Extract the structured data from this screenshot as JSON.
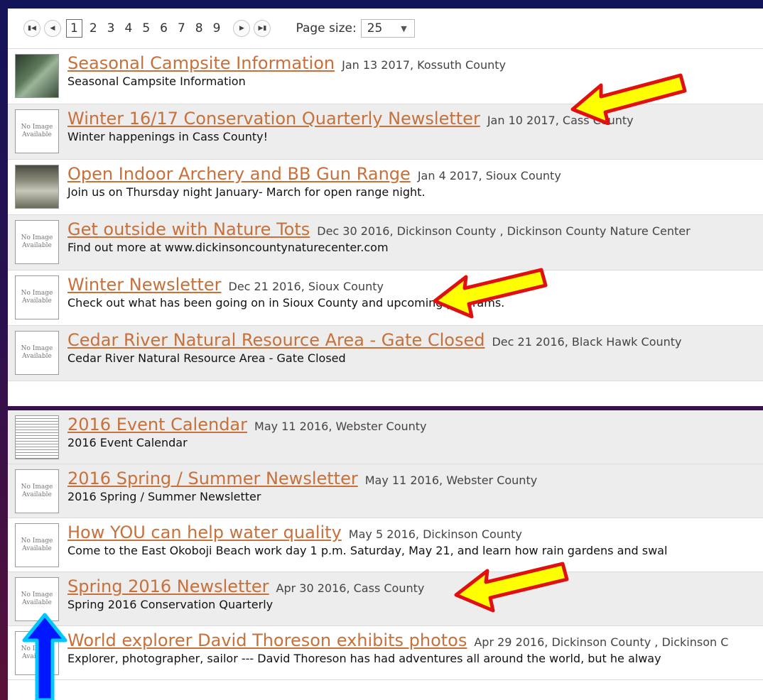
{
  "pager": {
    "first_icon": "first-page-icon",
    "prev_icon": "prev-page-icon",
    "next_icon": "next-page-icon",
    "last_icon": "last-page-icon",
    "pages": [
      "1",
      "2",
      "3",
      "4",
      "5",
      "6",
      "7",
      "8",
      "9"
    ],
    "current_page": "1",
    "page_size_label": "Page size:",
    "page_size_value": "25"
  },
  "top_items": [
    {
      "title": "Seasonal Campsite Information",
      "meta": "Jan 13 2017, Kossuth County",
      "desc": "Seasonal Campsite Information",
      "thumb": "photo"
    },
    {
      "title": "Winter 16/17 Conservation Quarterly Newsletter",
      "meta": "Jan 10 2017, Cass County",
      "desc": "Winter happenings in Cass County!",
      "thumb": "none"
    },
    {
      "title": "Open Indoor Archery and BB Gun Range",
      "meta": "Jan 4 2017, Sioux County",
      "desc": "Join us on Thursday night January- March for open range night.",
      "thumb": "photo"
    },
    {
      "title": "Get outside with Nature Tots",
      "meta": "Dec 30 2016, Dickinson County , Dickinson County Nature Center",
      "desc": "Find out more at www.dickinsoncountynaturecenter.com",
      "thumb": "none"
    },
    {
      "title": "Winter Newsletter",
      "meta": "Dec 21 2016, Sioux County",
      "desc": "Check out what has been going on in Sioux County and upcoming programs.",
      "thumb": "none"
    },
    {
      "title": "Cedar River Natural Resource Area - Gate Closed",
      "meta": "Dec 21 2016, Black Hawk County",
      "desc": "Cedar River Natural Resource Area - Gate Closed",
      "thumb": "none"
    }
  ],
  "bottom_items": [
    {
      "title": "2016 Event Calendar",
      "meta": "May 11 2016, Webster County",
      "desc": "2016 Event Calendar",
      "thumb": "doc"
    },
    {
      "title": "2016 Spring / Summer Newsletter",
      "meta": "May 11 2016, Webster County",
      "desc": "2016 Spring / Summer Newsletter",
      "thumb": "none"
    },
    {
      "title": "How YOU can help water quality",
      "meta": "May 5 2016, Dickinson County",
      "desc": "Come to the East Okoboji Beach work day 1 p.m. Saturday, May 21, and learn how rain gardens and swal",
      "thumb": "none"
    },
    {
      "title": "Spring 2016 Newsletter",
      "meta": "Apr 30 2016, Cass County",
      "desc": "Spring 2016 Conservation Quarterly",
      "thumb": "none"
    },
    {
      "title": "World explorer David Thoreson exhibits photos",
      "meta": "Apr 29 2016, Dickinson County , Dickinson C",
      "desc": "Explorer, photographer, sailor --- David Thoreson has had adventures all around the world, but he alway",
      "thumb": "none"
    }
  ],
  "no_image_text": [
    "No Image",
    "Available"
  ],
  "colors": {
    "link": "#c8703a",
    "arrow_fill": "#ffff00",
    "arrow_outline": "#e01010",
    "blue_arrow": "#0018ff",
    "blue_arrow_outline": "#00c8ff"
  }
}
